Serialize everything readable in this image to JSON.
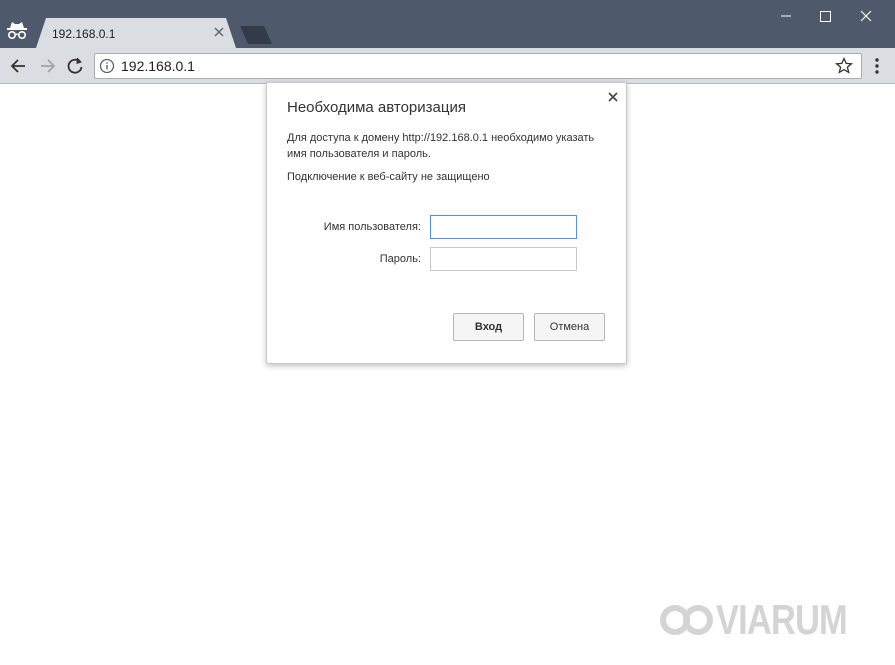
{
  "browser": {
    "tab_title": "192.168.0.1",
    "url": "192.168.0.1"
  },
  "dialog": {
    "title": "Необходима авторизация",
    "message": "Для доступа к домену http://192.168.0.1 необходимо указать имя пользователя и пароль.",
    "warning": "Подключение к веб-сайту не защищено",
    "username_label": "Имя пользователя:",
    "username_value": "",
    "password_label": "Пароль:",
    "password_value": "",
    "login_button": "Вход",
    "cancel_button": "Отмена"
  },
  "watermark": {
    "text": "VIARUM"
  },
  "icons": {
    "incognito": "incognito-icon",
    "tab_close": "close-icon",
    "back": "back-arrow-icon",
    "forward": "forward-arrow-icon",
    "reload": "reload-icon",
    "info": "info-icon",
    "star": "star-icon",
    "menu": "kebab-menu-icon",
    "minimize": "minimize-icon",
    "maximize": "maximize-icon",
    "window_close": "window-close-icon"
  },
  "colors": {
    "titlebar": "#4e5a6c",
    "toolbar": "#dadde2",
    "focus": "#4d90fe"
  }
}
